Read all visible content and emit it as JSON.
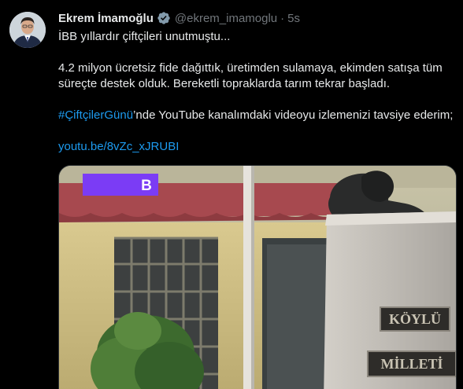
{
  "tweet": {
    "display_name": "Ekrem İmamoğlu",
    "handle": "@ekrem_imamoglu",
    "separator": "·",
    "time": "5s",
    "line1": "İBB yıllardır çiftçileri unutmuştu...",
    "line2": "4.2 milyon ücretsiz fide dağıttık, üretimden sulamaya, ekimden satışa tüm süreçte destek olduk. Bereketli topraklarda tarım tekrar başladı.",
    "hashtag": "#ÇiftçilerGünü",
    "line3_rest": "’nde YouTube kanalımdaki videoyu izlemenizi tavsiye ederim;",
    "link": "youtu.be/8vZc_xJRUBI"
  },
  "media": {
    "overlay_letter": "B",
    "plaque_text_1": "KÖYLÜ",
    "plaque_text_2": "MİLLETİ"
  },
  "colors": {
    "background": "#000000",
    "text": "#e7e9ea",
    "secondary": "#71767b",
    "accent": "#1d9bf0",
    "verified": "#829aab",
    "overlay": "#7b3cf5"
  },
  "icons": {
    "verified": "verified-badge-icon"
  }
}
